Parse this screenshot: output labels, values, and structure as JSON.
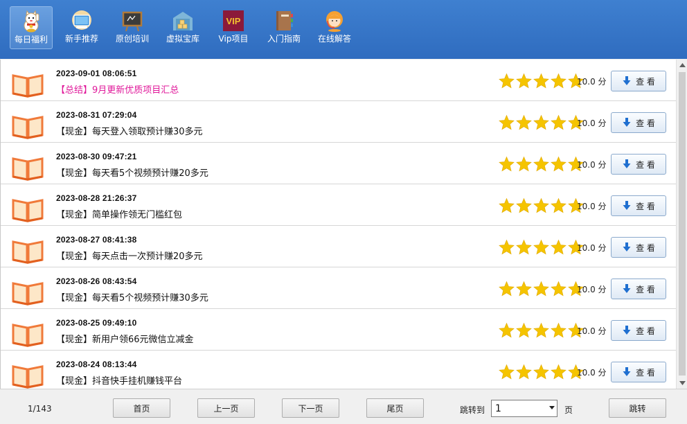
{
  "toolbar": {
    "items": [
      {
        "label": "每日福利",
        "icon": "lucky-cat-icon",
        "active": true
      },
      {
        "label": "新手推荐",
        "icon": "monitor-icon",
        "active": false
      },
      {
        "label": "原创培训",
        "icon": "blackboard-icon",
        "active": false
      },
      {
        "label": "虚拟宝库",
        "icon": "warehouse-icon",
        "active": false
      },
      {
        "label": "Vip项目",
        "icon": "vip-icon",
        "active": false
      },
      {
        "label": "入门指南",
        "icon": "notebook-icon",
        "active": false
      },
      {
        "label": "在线解答",
        "icon": "support-agent-icon",
        "active": false
      }
    ],
    "vip_badge_text": "VIP"
  },
  "list": {
    "rows": [
      {
        "date": "2023-09-01 08:06:51",
        "title": "【总结】9月更新优质项目汇总",
        "highlight": true,
        "rating": 5,
        "score": "10.0 分",
        "button": "查 看"
      },
      {
        "date": "2023-08-31 07:29:04",
        "title": "【现金】每天登入领取预计赚30多元",
        "highlight": false,
        "rating": 5,
        "score": "10.0 分",
        "button": "查 看"
      },
      {
        "date": "2023-08-30 09:47:21",
        "title": "【现金】每天看5个视频预计赚20多元",
        "highlight": false,
        "rating": 5,
        "score": "10.0 分",
        "button": "查 看"
      },
      {
        "date": "2023-08-28 21:26:37",
        "title": "【现金】简单操作领无门槛红包",
        "highlight": false,
        "rating": 5,
        "score": "10.0 分",
        "button": "查 看"
      },
      {
        "date": "2023-08-27 08:41:38",
        "title": "【现金】每天点击一次预计赚20多元",
        "highlight": false,
        "rating": 5,
        "score": "10.0 分",
        "button": "查 看"
      },
      {
        "date": "2023-08-26 08:43:54",
        "title": "【现金】每天看5个视频预计赚30多元",
        "highlight": false,
        "rating": 5,
        "score": "10.0 分",
        "button": "查 看"
      },
      {
        "date": "2023-08-25 09:49:10",
        "title": "【现金】新用户领66元微信立减金",
        "highlight": false,
        "rating": 5,
        "score": "10.0 分",
        "button": "查 看"
      },
      {
        "date": "2023-08-24 08:13:44",
        "title": "【现金】抖音快手挂机赚钱平台",
        "highlight": false,
        "rating": 5,
        "score": "10.0 分",
        "button": "查 看"
      }
    ]
  },
  "footer": {
    "page_count": "1/143",
    "first_label": "首页",
    "prev_label": "上一页",
    "next_label": "下一页",
    "last_label": "尾页",
    "jump_label": "跳转到",
    "jump_value": "1",
    "page_unit": "页",
    "jump_button": "跳转"
  },
  "colors": {
    "toolbar": "#3578c8",
    "highlight_title": "#e0189a",
    "star": "#f5c400",
    "book": "#f07a3a"
  }
}
